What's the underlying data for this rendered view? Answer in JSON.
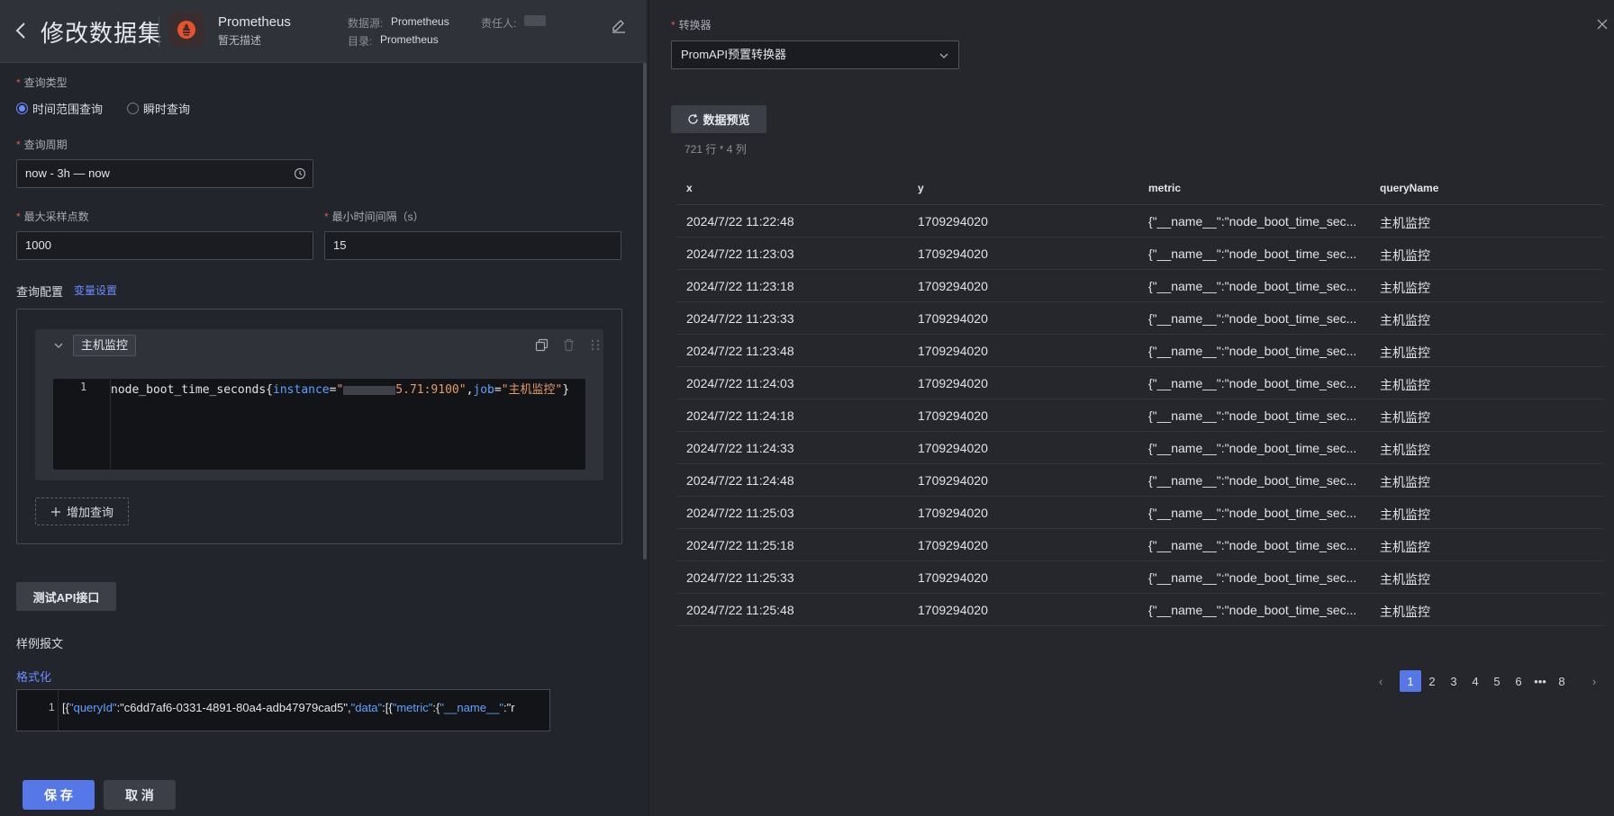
{
  "header": {
    "title": "修改数据集",
    "datasource_name": "Prometheus",
    "datasource_desc": "暂无描述",
    "meta": {
      "datasource_key": "数据源:",
      "datasource_value": "Prometheus",
      "catalog_key": "目录:",
      "catalog_value": "Prometheus",
      "owner_key": "责任人:"
    }
  },
  "form": {
    "query_type": {
      "label": "查询类型",
      "options": [
        "时间范围查询",
        "瞬时查询"
      ],
      "selected": "时间范围查询"
    },
    "query_period": {
      "label": "查询周期",
      "value": "now - 3h — now"
    },
    "max_points": {
      "label": "最大采样点数",
      "value": "1000"
    },
    "min_interval": {
      "label": "最小时间间隔（s）",
      "value": "15"
    },
    "query_config_label": "查询配置",
    "variable_settings_link": "变量设置",
    "query": {
      "name": "主机监控",
      "line_number": "1",
      "code": {
        "metric": "node_boot_time_seconds{",
        "key1": "instance",
        "eq1": "=",
        "str1_start": "\"",
        "str1_end": "5.71:9100\"",
        "comma": ",",
        "key2": "job",
        "eq2": "=",
        "str2": "\"主机监控\"",
        "close": "}"
      }
    },
    "add_query_label": "增加查询",
    "test_api_label": "测试API接口",
    "sample_label": "样例报文",
    "format_link": "格式化",
    "sample": {
      "line_number": "1",
      "text_prefix": "[{",
      "key1": "\"queryId\"",
      "val1": ":\"c6dd7af6-0331-4891-80a4-adb47979cad5\",",
      "key2": "\"data\"",
      "val2": ":[{",
      "key3": "\"metric\"",
      "val3": ":{",
      "key4": "\"__name__\"",
      "val4": ":\"r"
    }
  },
  "footer": {
    "save_label": "保 存",
    "cancel_label": "取 消"
  },
  "converter": {
    "label": "转换器",
    "value": "PromAPI预置转换器"
  },
  "preview": {
    "button_label": "数据预览",
    "row_count": "721 行 * 4 列",
    "columns": [
      "x",
      "y",
      "metric",
      "queryName"
    ],
    "rows": [
      [
        "2024/7/22 11:22:48",
        "1709294020",
        "{\"__name__\":\"node_boot_time_sec...",
        "主机监控"
      ],
      [
        "2024/7/22 11:23:03",
        "1709294020",
        "{\"__name__\":\"node_boot_time_sec...",
        "主机监控"
      ],
      [
        "2024/7/22 11:23:18",
        "1709294020",
        "{\"__name__\":\"node_boot_time_sec...",
        "主机监控"
      ],
      [
        "2024/7/22 11:23:33",
        "1709294020",
        "{\"__name__\":\"node_boot_time_sec...",
        "主机监控"
      ],
      [
        "2024/7/22 11:23:48",
        "1709294020",
        "{\"__name__\":\"node_boot_time_sec...",
        "主机监控"
      ],
      [
        "2024/7/22 11:24:03",
        "1709294020",
        "{\"__name__\":\"node_boot_time_sec...",
        "主机监控"
      ],
      [
        "2024/7/22 11:24:18",
        "1709294020",
        "{\"__name__\":\"node_boot_time_sec...",
        "主机监控"
      ],
      [
        "2024/7/22 11:24:33",
        "1709294020",
        "{\"__name__\":\"node_boot_time_sec...",
        "主机监控"
      ],
      [
        "2024/7/22 11:24:48",
        "1709294020",
        "{\"__name__\":\"node_boot_time_sec...",
        "主机监控"
      ],
      [
        "2024/7/22 11:25:03",
        "1709294020",
        "{\"__name__\":\"node_boot_time_sec...",
        "主机监控"
      ],
      [
        "2024/7/22 11:25:18",
        "1709294020",
        "{\"__name__\":\"node_boot_time_sec...",
        "主机监控"
      ],
      [
        "2024/7/22 11:25:33",
        "1709294020",
        "{\"__name__\":\"node_boot_time_sec...",
        "主机监控"
      ],
      [
        "2024/7/22 11:25:48",
        "1709294020",
        "{\"__name__\":\"node_boot_time_sec...",
        "主机监控"
      ]
    ],
    "pagination": {
      "pages": [
        "1",
        "2",
        "3",
        "4",
        "5",
        "6"
      ],
      "ellipsis": "•••",
      "last": "8",
      "current": "1"
    }
  },
  "colors": {
    "accent": "#5677e8",
    "link": "#6b8cff",
    "required": "#e05a4f",
    "background": "#23252c"
  }
}
